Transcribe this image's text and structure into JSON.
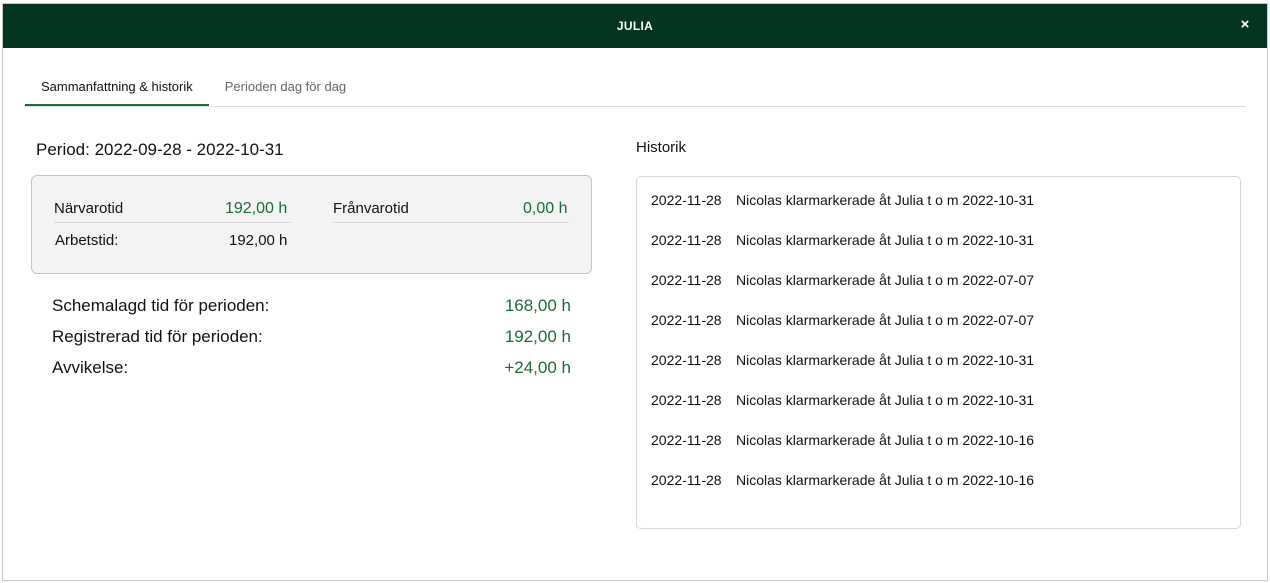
{
  "modal": {
    "title": "JULIA",
    "close_label": "×"
  },
  "tabs": [
    {
      "label": "Sammanfattning & historik",
      "active": true
    },
    {
      "label": "Perioden dag för dag",
      "active": false
    }
  ],
  "summary": {
    "period_label": "Period: 2022-09-28 - 2022-10-31",
    "narvarotid_label": "Närvarotid",
    "narvarotid_value": "192,00 h",
    "franvarotid_label": "Frånvarotid",
    "franvarotid_value": "0,00 h",
    "arbetstid_label": "Arbetstid:",
    "arbetstid_value": "192,00 h"
  },
  "totals": [
    {
      "label": "Schemalagd tid för perioden:",
      "value": "168,00 h"
    },
    {
      "label": "Registrerad tid för perioden:",
      "value": "192,00 h"
    },
    {
      "label": "Avvikelse:",
      "value": "+24,00 h"
    }
  ],
  "history": {
    "title": "Historik",
    "items": [
      {
        "date": "2022-11-28",
        "text": "Nicolas klarmarkerade åt Julia t o m 2022-10-31"
      },
      {
        "date": "2022-11-28",
        "text": "Nicolas klarmarkerade åt Julia t o m 2022-10-31"
      },
      {
        "date": "2022-11-28",
        "text": "Nicolas klarmarkerade åt Julia t o m 2022-07-07"
      },
      {
        "date": "2022-11-28",
        "text": "Nicolas klarmarkerade åt Julia t o m 2022-07-07"
      },
      {
        "date": "2022-11-28",
        "text": "Nicolas klarmarkerade åt Julia t o m 2022-10-31"
      },
      {
        "date": "2022-11-28",
        "text": "Nicolas klarmarkerade åt Julia t o m 2022-10-31"
      },
      {
        "date": "2022-11-28",
        "text": "Nicolas klarmarkerade åt Julia t o m 2022-10-16"
      },
      {
        "date": "2022-11-28",
        "text": "Nicolas klarmarkerade åt Julia t o m 2022-10-16"
      }
    ]
  },
  "colors": {
    "header_bg": "#023620",
    "accent_green": "#1b6b3a"
  }
}
